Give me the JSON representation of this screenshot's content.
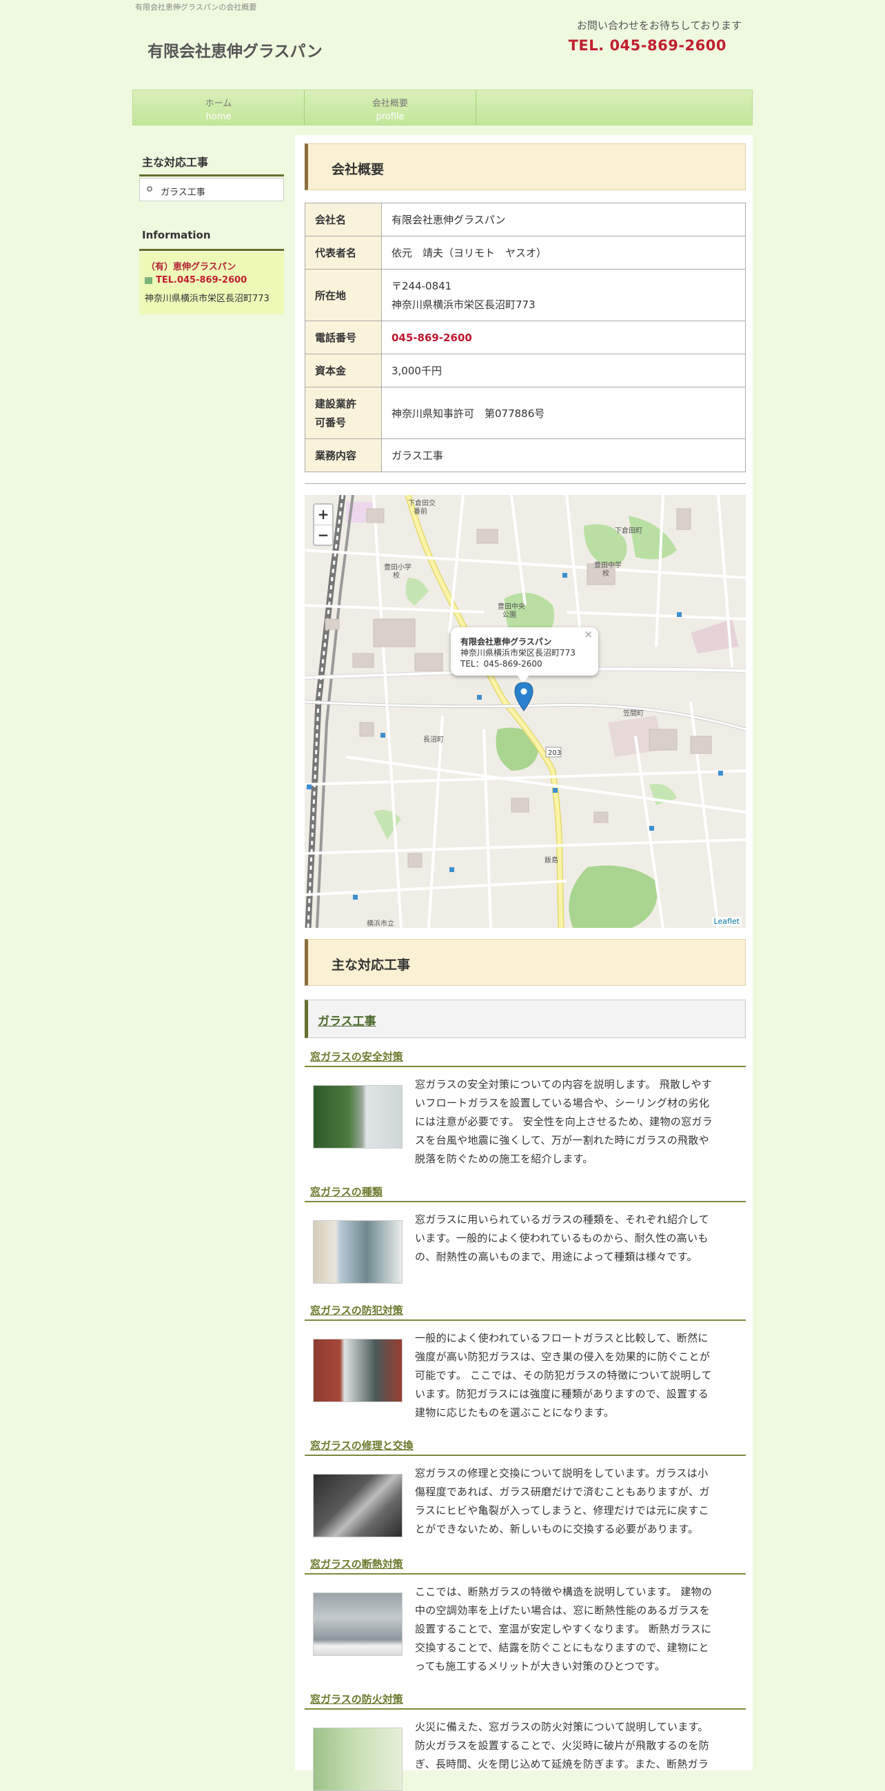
{
  "header": {
    "tagline": "有限会社恵伸グラスパンの会社概要",
    "site_title": "有限会社恵伸グラスパン",
    "contact_message": "お問い合わせをお待ちしております",
    "tel": "TEL. 045-869-2600"
  },
  "nav": {
    "items": [
      {
        "jp": "ホーム",
        "en": "home"
      },
      {
        "jp": "会社概要",
        "en": "profile"
      }
    ]
  },
  "sidebar": {
    "menu_heading": "主な対応工事",
    "menu_items": [
      "ガラス工事"
    ],
    "info_heading": "Information",
    "company": "（有）恵伸グラスパン",
    "tel": "TEL.045-869-2600",
    "address": "神奈川県横浜市栄区長沼町773"
  },
  "main": {
    "profile_title": "会社概要",
    "profile_rows": [
      {
        "label": "会社名",
        "value": "有限会社恵伸グラスパン"
      },
      {
        "label": "代表者名",
        "value": "依元　靖夫（ヨリモト　ヤスオ）"
      },
      {
        "label": "所在地",
        "value": "〒244-0841",
        "value2": "神奈川県横浜市栄区長沼町773"
      },
      {
        "label": "電話番号",
        "value": "045-869-2600"
      },
      {
        "label": "資本金",
        "value": "3,000千円"
      },
      {
        "label": "建設業許",
        "label2": "可番号",
        "value": "神奈川県知事許可　第077886号"
      },
      {
        "label": "業務内容",
        "value": "ガラス工事"
      }
    ],
    "map": {
      "zoom_in": "+",
      "zoom_out": "−",
      "popup_title": "有限会社恵伸グラスパン",
      "popup_address": "神奈川県横浜市栄区長沼町773",
      "popup_tel": "TEL：045-869-2600",
      "popup_close": "×",
      "attribution": "Leaflet",
      "labels": [
        "下倉田交番前",
        "下倉田町",
        "豊田小学校",
        "豊田中学校",
        "豊田中央公園",
        "長沼町",
        "飯島",
        "笠間町",
        "203",
        "横浜市立"
      ]
    },
    "works_title": "主な対応工事",
    "works_sub": "ガラス工事",
    "sections": [
      {
        "title": "窓ガラスの安全対策",
        "lines": [
          "窓ガラスの安全対策についての内容を説明します。 飛散しやす",
          "いフロートガラスを設置している場合や、シーリング材の劣化",
          "には注意が必要です。 安全性を向上させるため、建物の窓ガラ",
          "スを台風や地震に強くして、万が一割れた時にガラスの飛散や",
          "脱落を防ぐための施工を紹介します。"
        ]
      },
      {
        "title": "窓ガラスの種類",
        "lines": [
          "窓ガラスに用いられているガラスの種類を、それぞれ紹介して",
          "います。一般的によく使われているものから、耐久性の高いも",
          "の、耐熱性の高いものまで、用途によって種類は様々です。"
        ]
      },
      {
        "title": "窓ガラスの防犯対策",
        "lines": [
          "一般的によく使われているフロートガラスと比較して、断然に",
          "強度が高い防犯ガラスは、空き巣の侵入を効果的に防ぐことが",
          "可能です。 ここでは、その防犯ガラスの特徴について説明して",
          "います。防犯ガラスには強度に種類がありますので、設置する",
          "建物に応じたものを選ぶことになります。"
        ]
      },
      {
        "title": "窓ガラスの修理と交換",
        "lines": [
          "窓ガラスの修理と交換について説明をしています。ガラスは小",
          "傷程度であれば、ガラス研磨だけで済むこともありますが、ガ",
          "ラスにヒビや亀裂が入ってしまうと、修理だけでは元に戻すこ",
          "とができないため、新しいものに交換する必要があります。"
        ]
      },
      {
        "title": "窓ガラスの断熱対策",
        "lines": [
          "ここでは、断熱ガラスの特徴や構造を説明しています。 建物の",
          "中の空調効率を上げたい場合は、窓に断熱性能のあるガラスを",
          "設置することで、室温が安定しやすくなります。 断熱ガラスに",
          "交換することで、結露を防ぐことにもなりますので、建物にと",
          "っても施工するメリットが大きい対策のひとつです。"
        ]
      },
      {
        "title": "窓ガラスの防火対策",
        "lines": [
          "火災に備えた、窓ガラスの防火対策について説明しています。",
          "防火ガラスを設置することで、火災時に破片が飛散するのを防",
          "ぎ、長時間、火を閉じ込めて延焼を防ぎます。また、断熱ガラ"
        ]
      }
    ]
  },
  "colors": {
    "page_bg": "#eff9df",
    "accent_red": "#c01f2f",
    "title_box_bg": "#faf0d3",
    "rule_olive": "#666f2e"
  }
}
